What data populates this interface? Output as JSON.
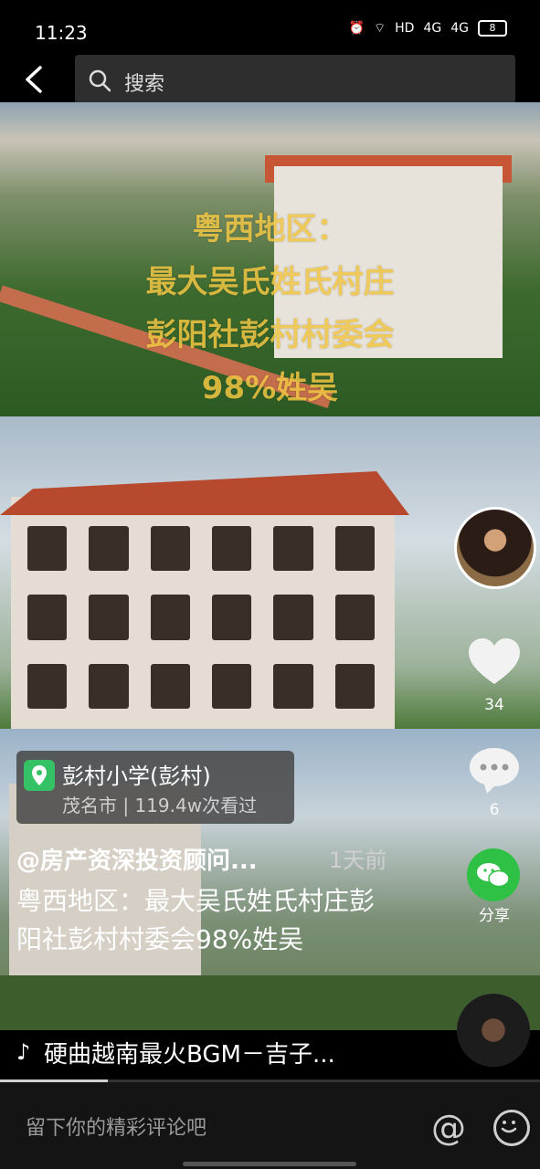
{
  "status_bar": {
    "time": "11:23",
    "network": "HD",
    "signal1": "4G",
    "signal2": "4G",
    "battery": "8"
  },
  "search": {
    "placeholder": "搜索"
  },
  "video": {
    "overlay_title_lines": [
      "粤西地区：",
      "最大吴氏姓氏村庄",
      "彭阳社彭村村委会",
      "98%姓吴"
    ]
  },
  "sidebar": {
    "like_count": "34",
    "comment_count": "6",
    "share_label": "分享"
  },
  "location": {
    "name": "彭村小学(彭村)",
    "sub": "茂名市 | 119.4w次看过"
  },
  "post": {
    "author": "@房产资深投资顾问...",
    "time_ago": "1天前",
    "description": "粤西地区：最大吴氏姓氏村庄彭阳社彭村村委会98%姓吴"
  },
  "music": {
    "note_icon": "♪",
    "title": "硬曲越南最火BGM－吉子..."
  },
  "progress": {
    "fraction": 0.2
  },
  "comment_bar": {
    "placeholder": "留下你的精彩评论吧",
    "at_symbol": "@"
  },
  "colors": {
    "overlay_text": "#f1c644",
    "share_green": "#2fc146",
    "location_pin": "#35c267"
  }
}
